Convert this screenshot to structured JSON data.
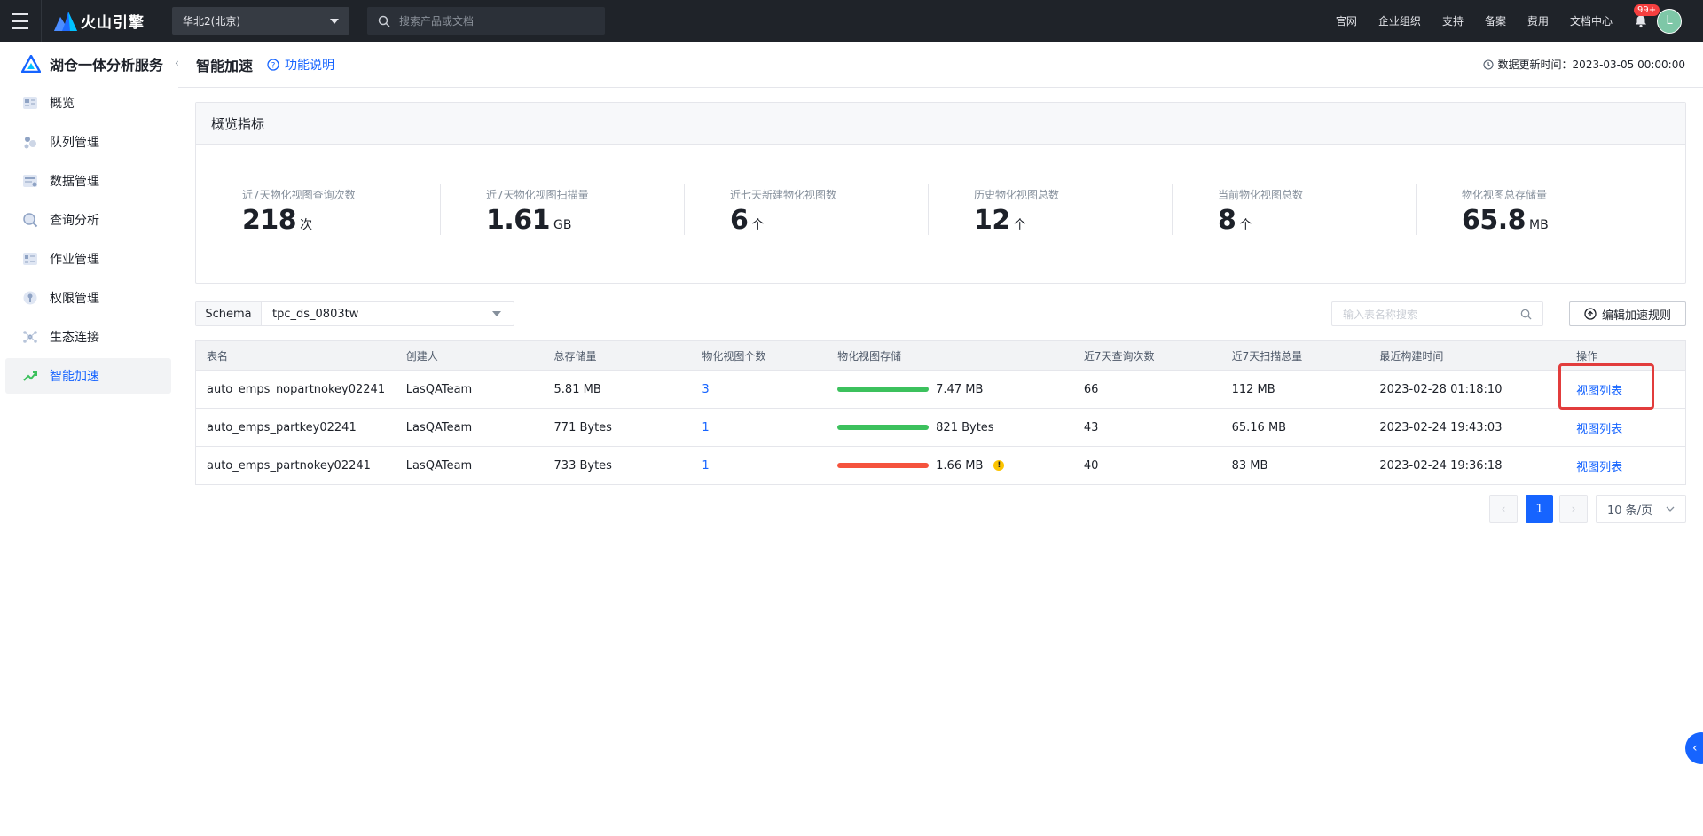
{
  "topbar": {
    "brand": "火山引擎",
    "region": "华北2(北京)",
    "search_placeholder": "搜索产品或文档",
    "nav": [
      "官网",
      "企业组织",
      "支持",
      "备案",
      "费用",
      "文档中心"
    ],
    "notification_badge": "99+",
    "avatar_letter": "L"
  },
  "sidebar": {
    "title": "湖仓一体分析服务",
    "items": [
      {
        "label": "概览",
        "icon": "overview-icon"
      },
      {
        "label": "队列管理",
        "icon": "queue-icon"
      },
      {
        "label": "数据管理",
        "icon": "data-icon"
      },
      {
        "label": "查询分析",
        "icon": "query-icon"
      },
      {
        "label": "作业管理",
        "icon": "job-icon"
      },
      {
        "label": "权限管理",
        "icon": "permission-icon"
      },
      {
        "label": "生态连接",
        "icon": "ecosystem-icon"
      },
      {
        "label": "智能加速",
        "icon": "acceleration-icon",
        "active": true
      }
    ]
  },
  "header": {
    "title": "智能加速",
    "help_link": "功能说明",
    "update_time": "数据更新时间：2023-03-05 00:00:00"
  },
  "overview": {
    "title": "概览指标",
    "metrics": [
      {
        "label": "近7天物化视图查询次数",
        "value": "218",
        "unit": "次"
      },
      {
        "label": "近7天物化视图扫描量",
        "value": "1.61",
        "unit": "GB"
      },
      {
        "label": "近七天新建物化视图数",
        "value": "6",
        "unit": "个"
      },
      {
        "label": "历史物化视图总数",
        "value": "12",
        "unit": "个"
      },
      {
        "label": "当前物化视图总数",
        "value": "8",
        "unit": "个"
      },
      {
        "label": "物化视图总存储量",
        "value": "65.8",
        "unit": "MB"
      }
    ]
  },
  "filters": {
    "schema_label": "Schema",
    "schema_value": "tpc_ds_0803tw",
    "search_placeholder": "输入表名称搜索",
    "edit_rules_label": "编辑加速规则"
  },
  "table": {
    "columns": [
      "表名",
      "创建人",
      "总存储量",
      "物化视图个数",
      "物化视图存储",
      "近7天查询次数",
      "近7天扫描总量",
      "最近构建时间",
      "操作"
    ],
    "rows": [
      {
        "name": "auto_emps_nopartnokey02241",
        "creator": "LasQATeam",
        "total_storage": "5.81 MB",
        "view_count": "3",
        "view_storage": "7.47 MB",
        "bar_color": "#3cc15d",
        "warning": false,
        "queries_7d": "66",
        "scan_7d": "112 MB",
        "last_build": "2023-02-28 01:18:10",
        "action": "视图列表"
      },
      {
        "name": "auto_emps_partkey02241",
        "creator": "LasQATeam",
        "total_storage": "771 Bytes",
        "view_count": "1",
        "view_storage": "821 Bytes",
        "bar_color": "#3cc15d",
        "warning": false,
        "queries_7d": "43",
        "scan_7d": "65.16 MB",
        "last_build": "2023-02-24 19:43:03",
        "action": "视图列表"
      },
      {
        "name": "auto_emps_partnokey02241",
        "creator": "LasQATeam",
        "total_storage": "733 Bytes",
        "view_count": "1",
        "view_storage": "1.66 MB",
        "bar_color": "#f5533d",
        "warning": true,
        "queries_7d": "40",
        "scan_7d": "83 MB",
        "last_build": "2023-02-24 19:36:18",
        "action": "视图列表"
      }
    ]
  },
  "pagination": {
    "current_page": "1",
    "page_size": "10 条/页"
  },
  "colors": {
    "accent": "#1664ff",
    "topbar_bg": "#1f2329",
    "highlight": "#e23c3c"
  }
}
